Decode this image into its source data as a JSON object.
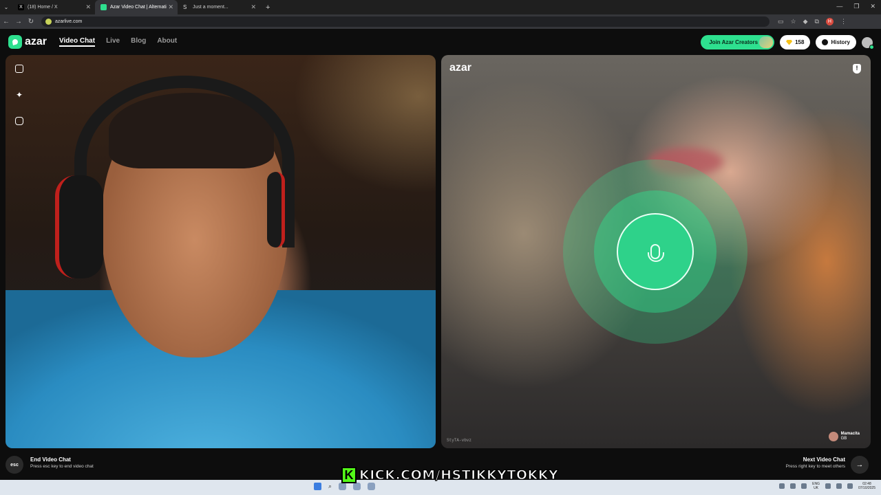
{
  "browser": {
    "tabs": [
      {
        "title": "(18) Home / X",
        "active": false
      },
      {
        "title": "Azar Video Chat | Alternati",
        "active": true
      },
      {
        "title": "Just a moment...",
        "active": false
      }
    ],
    "url": "azarlive.com",
    "profile_initial": "H"
  },
  "site": {
    "brand": "azar",
    "nav": [
      "Video Chat",
      "Live",
      "Blog",
      "About"
    ],
    "join_creators": "Join Azar Creators",
    "gems": "158",
    "history": "History"
  },
  "remote": {
    "watermark": "azar",
    "peer_id": "StyTA-vbvz",
    "peer_name": "Mamacita",
    "peer_country": "GB"
  },
  "footer": {
    "esc_key": "esc",
    "end_title": "End Video Chat",
    "end_hint": "Press esc key to end video chat",
    "next_title": "Next Video Chat",
    "next_hint": "Press right key to meet others"
  },
  "overlay": {
    "kick_logo": "K",
    "kick_text": "KICK.COM/HSTIKKYTOKKY"
  },
  "taskbar": {
    "lang": "ENG",
    "region": "UK",
    "time": "02:48",
    "date": "07/10/2025"
  },
  "colors": {
    "accent": "#2ee08f",
    "kick_green": "#53fc18"
  }
}
